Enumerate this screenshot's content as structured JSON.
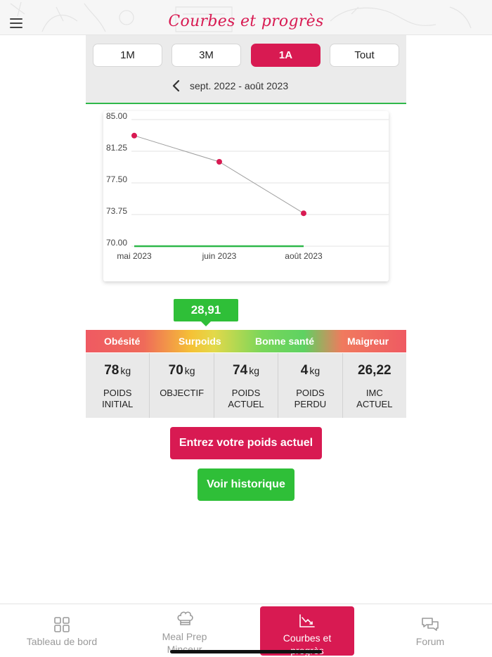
{
  "header": {
    "title": "Courbes et progrès"
  },
  "period": {
    "options": [
      "1M",
      "3M",
      "1A",
      "Tout"
    ],
    "selected": "1A",
    "range_label": "sept. 2022 - août 2023"
  },
  "chart_data": {
    "type": "line",
    "x": [
      "mai 2023",
      "juin 2023",
      "août 2023"
    ],
    "series": [
      {
        "values": [
          83.1,
          80.0,
          73.9
        ],
        "color": "#d81a52"
      },
      {
        "values": [
          70.0,
          70.0,
          70.0
        ],
        "color": "#2fb84a"
      }
    ],
    "y_ticks": [
      "85.00",
      "81.25",
      "77.50",
      "73.75",
      "70.00"
    ],
    "ylim": [
      70.0,
      85.0
    ],
    "grid": true,
    "title": "",
    "xlabel": "",
    "ylabel": ""
  },
  "bmi": {
    "value": "28,91",
    "categories": [
      "Obésité",
      "Surpoids",
      "Bonne santé",
      "Maigreur"
    ]
  },
  "stats": [
    {
      "value": "78",
      "unit": "kg",
      "label": "POIDS INITIAL"
    },
    {
      "value": "70",
      "unit": "kg",
      "label": "OBJECTIF"
    },
    {
      "value": "74",
      "unit": "kg",
      "label": "POIDS ACTUEL"
    },
    {
      "value": "4",
      "unit": "kg",
      "label": "POIDS PERDU"
    },
    {
      "value": "26,22",
      "unit": "",
      "label": "IMC ACTUEL"
    }
  ],
  "actions": {
    "enter_weight": "Entrez votre poids actuel",
    "history": "Voir historique"
  },
  "bottom_nav": [
    {
      "label": "Tableau de bord",
      "icon": "dashboard-grid-icon",
      "active": false
    },
    {
      "label": "Meal Prep Minceur",
      "icon": "chef-hat-icon",
      "active": false
    },
    {
      "label": "Courbes et progrès",
      "icon": "chart-icon",
      "active": true
    },
    {
      "label": "Forum",
      "icon": "chat-bubbles-icon",
      "active": false
    }
  ],
  "colors": {
    "accent": "#d81a52",
    "success": "#2fbf38"
  }
}
